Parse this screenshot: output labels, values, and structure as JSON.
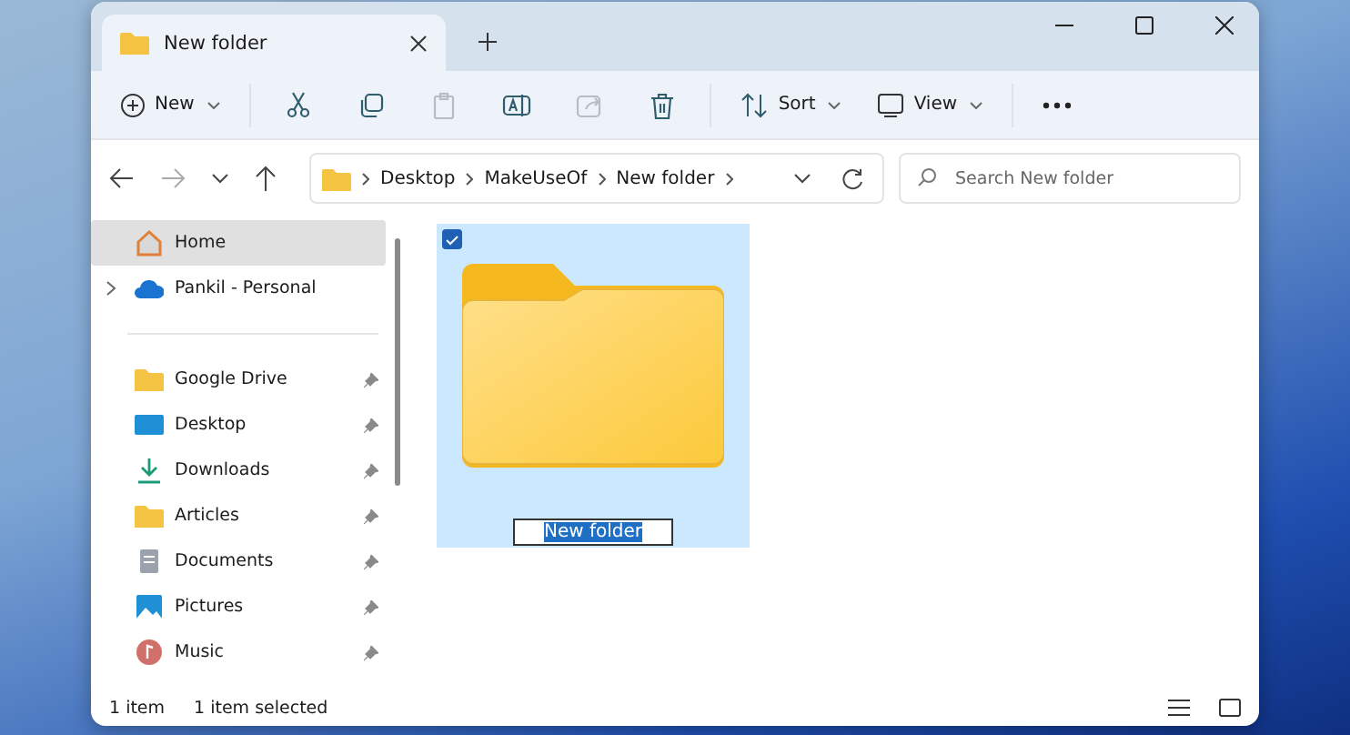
{
  "tabs": [
    {
      "label": "New folder",
      "selected": true
    }
  ],
  "toolbar": {
    "new_label": "New",
    "actions": [
      {
        "kind": "cut",
        "disabled": false
      },
      {
        "kind": "copy",
        "disabled": false
      },
      {
        "kind": "paste",
        "disabled": true
      },
      {
        "kind": "rename",
        "disabled": false
      },
      {
        "kind": "share",
        "disabled": true
      },
      {
        "kind": "delete",
        "disabled": false
      }
    ],
    "sort_label": "Sort",
    "view_label": "View"
  },
  "address": {
    "breadcrumbs": [
      "Desktop",
      "MakeUseOf",
      "New folder"
    ],
    "search_placeholder": "Search New folder"
  },
  "sidebar": {
    "items": [
      {
        "label": "Home",
        "kind": "home",
        "selected": true,
        "expandable": false,
        "pinned": false
      },
      {
        "label": "Pankil - Personal",
        "kind": "cloud",
        "selected": false,
        "expandable": true,
        "pinned": false
      },
      {
        "label": "Google Drive",
        "kind": "folder",
        "selected": false,
        "expandable": false,
        "pinned": true
      },
      {
        "label": "Desktop",
        "kind": "desktop",
        "selected": false,
        "expandable": false,
        "pinned": true
      },
      {
        "label": "Downloads",
        "kind": "downloads",
        "selected": false,
        "expandable": false,
        "pinned": true
      },
      {
        "label": "Articles",
        "kind": "folder",
        "selected": false,
        "expandable": false,
        "pinned": true
      },
      {
        "label": "Documents",
        "kind": "documents",
        "selected": false,
        "expandable": false,
        "pinned": true
      },
      {
        "label": "Pictures",
        "kind": "pictures",
        "selected": false,
        "expandable": false,
        "pinned": true
      },
      {
        "label": "Music",
        "kind": "music",
        "selected": false,
        "expandable": false,
        "pinned": true
      }
    ]
  },
  "files": [
    {
      "name": "New folder",
      "selected": true,
      "checked": true,
      "renaming": true
    }
  ],
  "status_bar": [
    "1 item",
    "1 item selected"
  ]
}
